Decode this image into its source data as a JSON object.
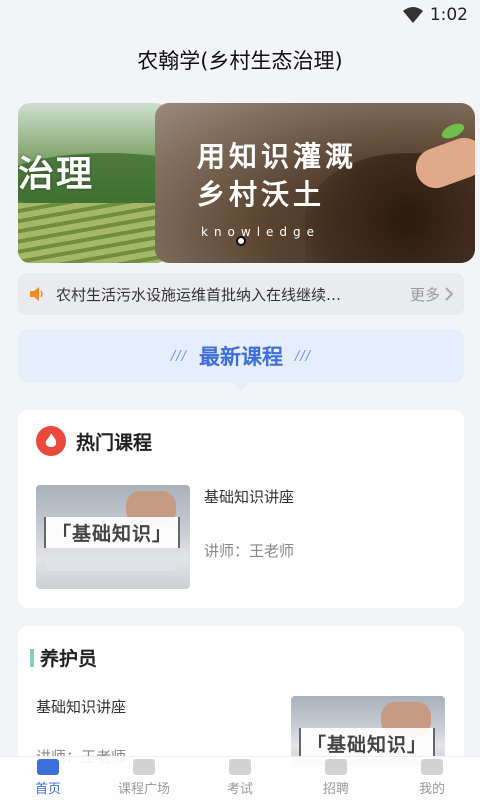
{
  "status_bar": {
    "time": "1:02"
  },
  "header": {
    "title": "农翰学(乡村生态治理)"
  },
  "banner": {
    "left_slide_text": "治理",
    "main_line1": "用知识灌溉",
    "main_line2": "乡村沃土",
    "main_keyword": "knowledge"
  },
  "notice": {
    "text": "农村生活污水设施运维首批纳入在线继续…",
    "more_label": "更多"
  },
  "latest": {
    "slashes_left": "///",
    "title": "最新课程",
    "slashes_right": "///"
  },
  "hot": {
    "title": "热门课程",
    "course": {
      "thumb_label": "「基础知识」",
      "name": "基础知识讲座",
      "teacher": "讲师：王老师"
    }
  },
  "keeper": {
    "title": "养护员",
    "course": {
      "name": "基础知识讲座",
      "teacher": "讲师：王老师",
      "thumb_label": "「基础知识」"
    }
  },
  "tabbar": {
    "tabs": [
      {
        "label": "首页"
      },
      {
        "label": "课程广场"
      },
      {
        "label": "考试"
      },
      {
        "label": "招聘"
      },
      {
        "label": "我的"
      }
    ]
  },
  "colors": {
    "accent": "#3d6fd8",
    "fire": "#e9483b",
    "green_bar": "#7fd6b5"
  }
}
